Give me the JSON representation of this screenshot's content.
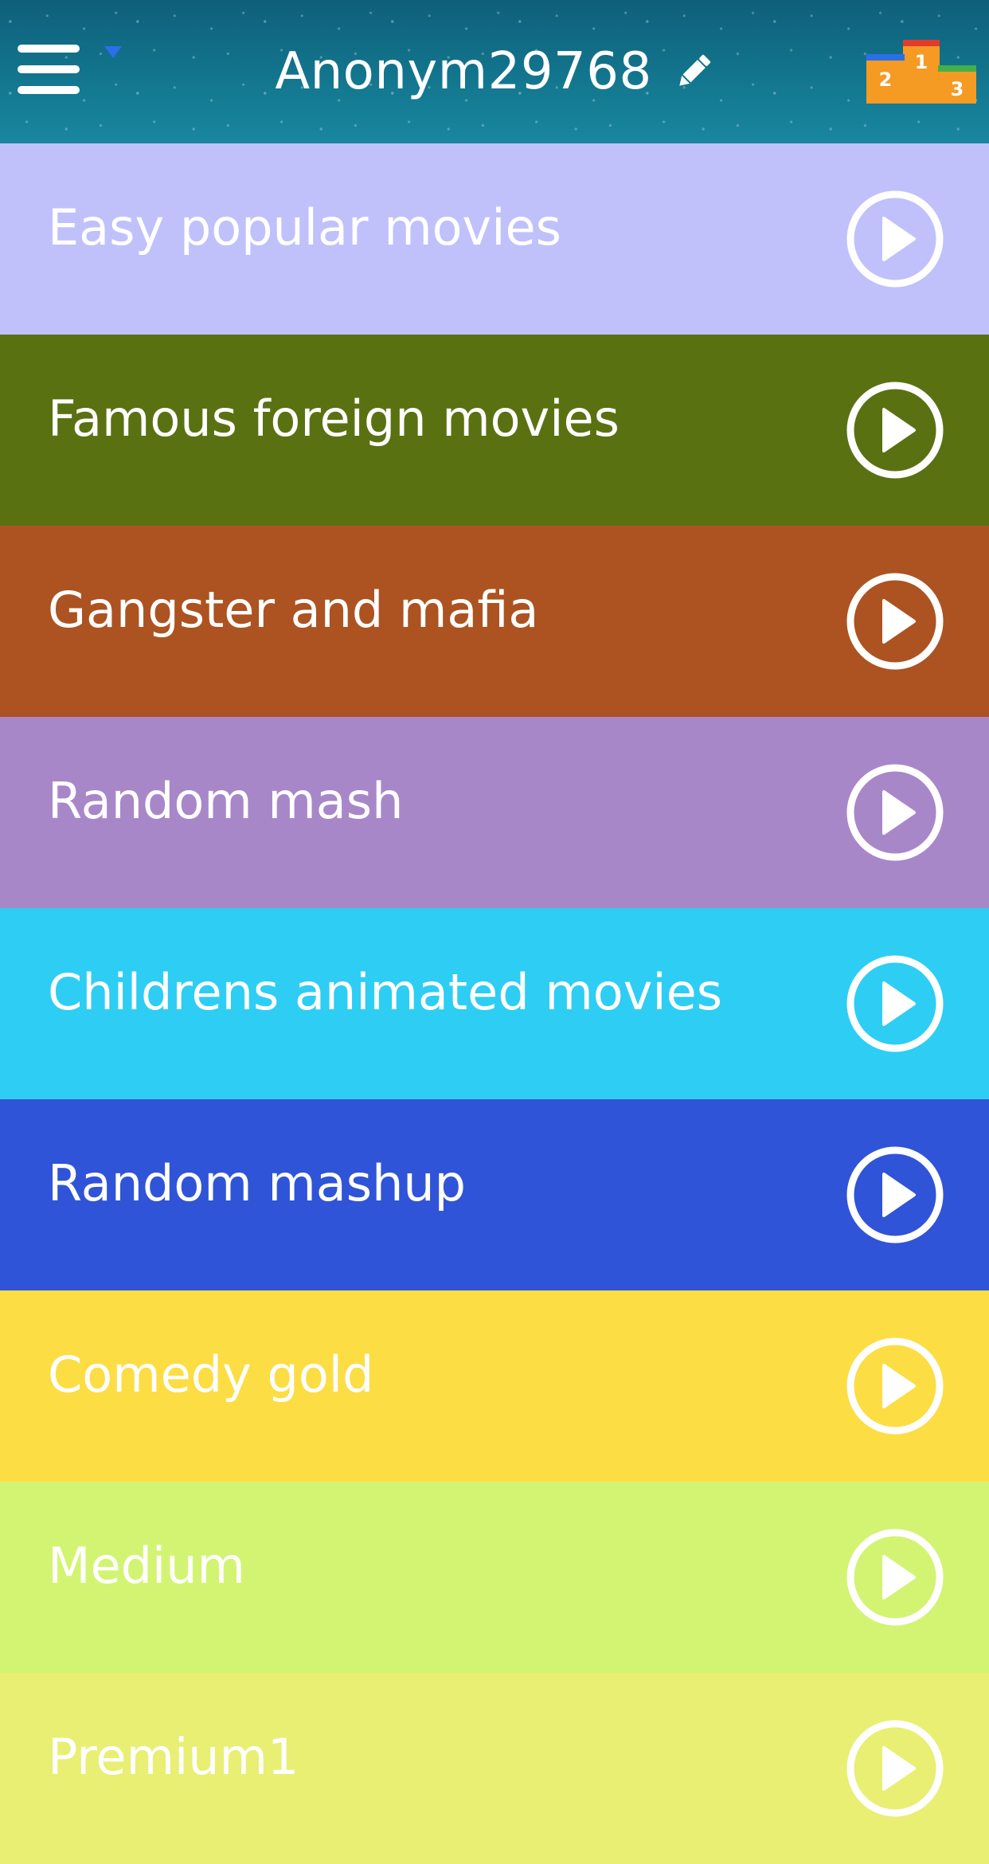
{
  "header": {
    "username": "Anonym29768",
    "background": "#137890"
  },
  "categories": [
    {
      "label": "Easy popular movies",
      "color": "#c0c1fb"
    },
    {
      "label": "Famous foreign movies",
      "color": "#5a7112"
    },
    {
      "label": "Gangster and mafia",
      "color": "#ac5321"
    },
    {
      "label": "Random mash",
      "color": "#a887c9"
    },
    {
      "label": "Childrens animated movies",
      "color": "#2ecdf4"
    },
    {
      "label": "Random mashup",
      "color": "#3054d7"
    },
    {
      "label": "Comedy gold",
      "color": "#fcdd44"
    },
    {
      "label": "Medium",
      "color": "#d3f472"
    },
    {
      "label": "Premium1",
      "color": "#e8ef73"
    }
  ],
  "icons": {
    "menu": "hamburger-menu-icon",
    "notification": "notification-arrow-icon",
    "edit": "pencil-icon",
    "leaderboard": "podium-icon",
    "play": "play-circle-icon"
  },
  "podium_colors": {
    "first": "#e23b2e",
    "second": "#2a6fe8",
    "third": "#43b04a",
    "base": "#f59a23"
  }
}
